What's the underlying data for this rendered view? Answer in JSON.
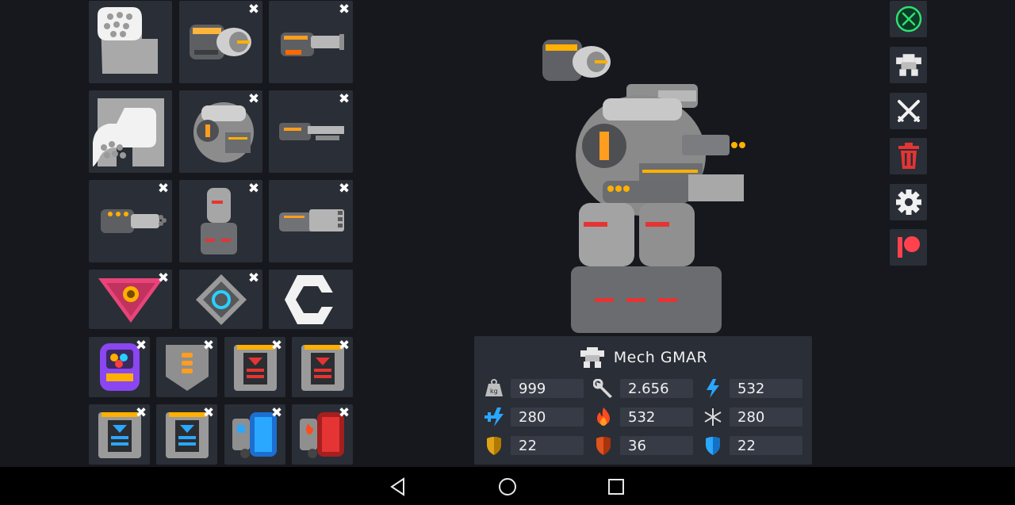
{
  "mech": {
    "name": "Mech GMAR"
  },
  "stats": [
    {
      "icon": "weight-icon",
      "value": "999"
    },
    {
      "icon": "wrench-icon",
      "value": "2.656"
    },
    {
      "icon": "energy-icon",
      "value": "532"
    },
    {
      "icon": "energy-regen-icon",
      "value": "280"
    },
    {
      "icon": "fire-icon",
      "value": "532"
    },
    {
      "icon": "freeze-icon",
      "value": "280"
    },
    {
      "icon": "armor-yellow-shield-icon",
      "value": "22"
    },
    {
      "icon": "armor-red-shield-icon",
      "value": "36"
    },
    {
      "icon": "armor-blue-shield-icon",
      "value": "22"
    }
  ],
  "inventory": {
    "slots": [
      {
        "item": "left-arm-weapon-slot-empty",
        "removable": false
      },
      {
        "item": "rotary-cannon-weapon",
        "removable": true
      },
      {
        "item": "heavy-gun-weapon",
        "removable": true
      },
      {
        "item": "right-arm-weapon-slot-empty",
        "removable": false
      },
      {
        "item": "armored-torso",
        "removable": true
      },
      {
        "item": "long-cannon-weapon",
        "removable": true
      },
      {
        "item": "gatling-weapon",
        "removable": true
      },
      {
        "item": "mech-legs",
        "removable": true
      },
      {
        "item": "rocket-pod-weapon",
        "removable": true
      },
      {
        "item": "drone-module",
        "removable": true
      },
      {
        "item": "teleport-module",
        "removable": true
      },
      {
        "item": "specials-slot-empty",
        "removable": false
      },
      {
        "item": "purple-battery-module",
        "removable": true
      },
      {
        "item": "grey-armor-module",
        "removable": true
      },
      {
        "item": "red-armor-module",
        "removable": true
      },
      {
        "item": "red-armor-module",
        "removable": true
      },
      {
        "item": "blue-armor-module",
        "removable": true
      },
      {
        "item": "blue-armor-module",
        "removable": true
      },
      {
        "item": "blue-energy-module",
        "removable": true
      },
      {
        "item": "red-heat-module",
        "removable": true
      }
    ]
  },
  "side_buttons": [
    "battle-icon",
    "mech-icon",
    "crossed-swords-icon",
    "trash-icon",
    "gear-icon",
    "patreon-icon"
  ],
  "colors": {
    "background": "#16181d",
    "slot": "#2a2e36",
    "accent_green": "#2ee070",
    "danger": "#e53434",
    "energy": "#2aa7ff",
    "fire": "#ff4b1e"
  }
}
